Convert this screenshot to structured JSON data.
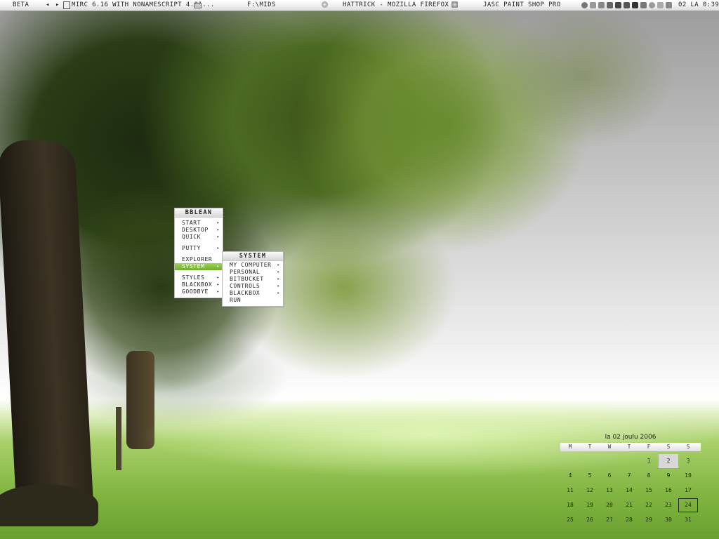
{
  "topbar": {
    "workspace": "BETA",
    "prev_glyph": "◂",
    "next_glyph": "▸",
    "tasks": [
      {
        "label": "MIRC 6.16 WITH NONAMESCRIPT 4.01...",
        "icon": "mirc-app-icon"
      },
      {
        "label": "F:\\MIDS",
        "icon": "folder-icon"
      },
      {
        "label": "HATTRICK - MOZILLA FIREFOX",
        "icon": "firefox-icon"
      },
      {
        "label": "JASC PAINT SHOP PRO",
        "icon": "paint-shop-pro-icon"
      }
    ],
    "tray_icons": [
      "gear-tray-icon",
      "network-tray-icon",
      "user-tray-icon",
      "audio-tray-icon",
      "app-tray-icon",
      "tools-tray-icon",
      "display-tray-icon",
      "misc-tray-icon",
      "settings-tray-icon",
      "update-tray-icon",
      "sync-tray-icon"
    ],
    "clock": "02 LA 0:39"
  },
  "main_menu": {
    "title": "BBLEAN",
    "arrow_glyph": "▸",
    "groups": [
      [
        {
          "label": "START",
          "submenu": true
        },
        {
          "label": "DESKTOP",
          "submenu": true
        },
        {
          "label": "QUICK",
          "submenu": true
        }
      ],
      [
        {
          "label": "PUTTY",
          "submenu": true
        }
      ],
      [
        {
          "label": "EXPLORER",
          "submenu": false
        },
        {
          "label": "SYSTEM",
          "submenu": true,
          "active": true
        }
      ],
      [
        {
          "label": "STYLES",
          "submenu": true
        },
        {
          "label": "BLACKBOX",
          "submenu": true
        },
        {
          "label": "GOODBYE",
          "submenu": true
        }
      ]
    ]
  },
  "system_menu": {
    "title": "SYSTEM",
    "arrow_glyph": "▸",
    "items": [
      {
        "label": "MY COMPUTER",
        "submenu": true
      },
      {
        "label": "PERSONAL",
        "submenu": true
      },
      {
        "label": "BITBUCKET",
        "submenu": true
      },
      {
        "label": "CONTROLS",
        "submenu": true
      },
      {
        "label": "BLACKBOX",
        "submenu": true
      },
      {
        "label": "RUN",
        "submenu": false
      }
    ]
  },
  "calendar": {
    "title": "la 02 joulu  2006",
    "weekdays": [
      "M",
      "T",
      "W",
      "T",
      "F",
      "S",
      "S"
    ],
    "weeks": [
      [
        "",
        "",
        "",
        "",
        "1",
        "2",
        "3"
      ],
      [
        "4",
        "5",
        "6",
        "7",
        "8",
        "9",
        "10"
      ],
      [
        "11",
        "12",
        "13",
        "14",
        "15",
        "16",
        "17"
      ],
      [
        "18",
        "19",
        "20",
        "21",
        "22",
        "23",
        "24"
      ],
      [
        "25",
        "26",
        "27",
        "28",
        "29",
        "30",
        "31"
      ]
    ],
    "today": "2",
    "boxed": "24"
  },
  "colors": {
    "menu_highlight": "#7fbd3a",
    "grass": "#7fb43f",
    "foliage": "#3d5a1a",
    "fog": "#f2f2f2"
  }
}
